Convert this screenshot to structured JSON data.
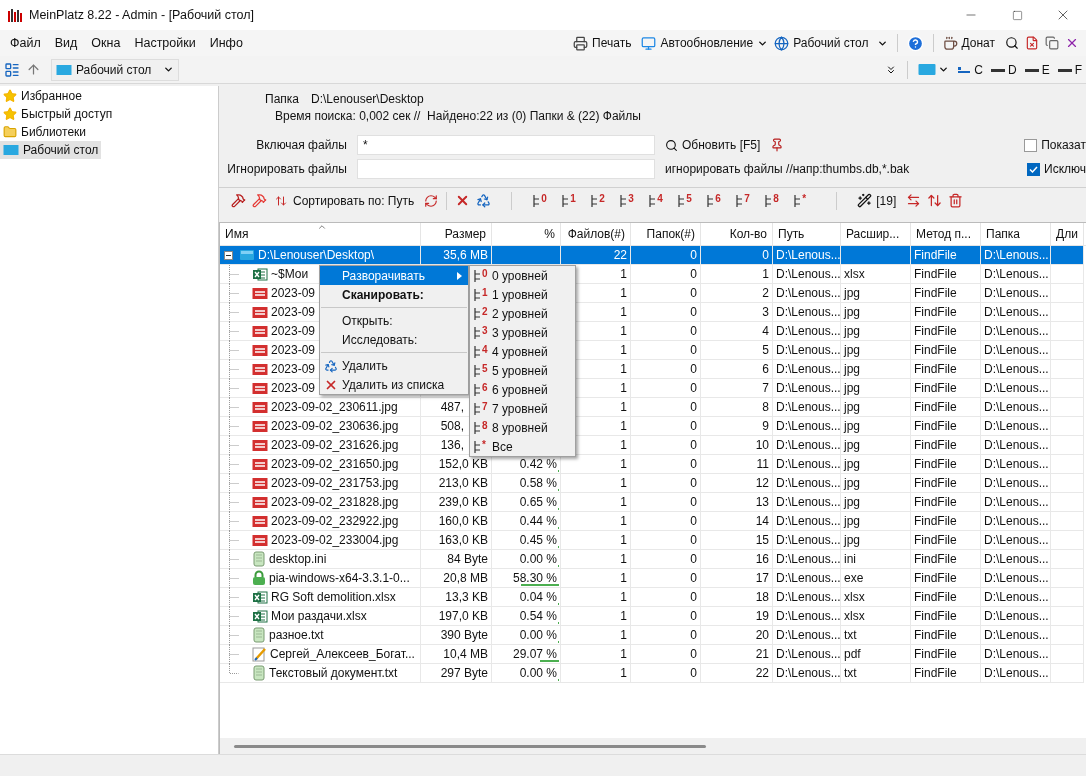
{
  "window": {
    "title": "MeinPlatz 8.22 - Admin - [Рабочий стол]"
  },
  "menu": [
    "Файл",
    "Вид",
    "Окна",
    "Настройки",
    "Инфо"
  ],
  "top_toolbar": {
    "print": "Печать",
    "auto_update": "Автообновление",
    "location": "Рабочий стол",
    "donate": "Донат"
  },
  "nav_toolbar": {
    "location": "Рабочий стол",
    "drives": [
      "C",
      "D",
      "E",
      "F"
    ]
  },
  "sidebar": {
    "items": [
      {
        "label": "Избранное",
        "kind": "star",
        "selected": false
      },
      {
        "label": "Быстрый доступ",
        "kind": "star",
        "selected": false
      },
      {
        "label": "Библиотеки",
        "kind": "folder",
        "selected": false
      },
      {
        "label": "Рабочий стол",
        "kind": "desktop",
        "selected": true
      }
    ]
  },
  "info": {
    "folder_label": "Папка",
    "folder": "D:\\Lenouser\\Desktop",
    "stats": "Время поиска: 0,002 сек //  Найдено:22 из (0) Папки & (22) Файлы"
  },
  "filters": {
    "include_label": "Включая файлы",
    "include_value": "*",
    "ignore_label": "Игнорировать файлы",
    "refresh": "Обновить [F5]",
    "ignore_hint": "игнорировать файлы //напр:thumbs.db,*.bak",
    "options": [
      {
        "label": "Показат",
        "checked": false
      },
      {
        "label": "Исключ",
        "checked": true
      }
    ]
  },
  "list_toolbar": {
    "sort": "Сортировать по: Путь",
    "levels": [
      "0",
      "1",
      "2",
      "3",
      "4",
      "5",
      "6",
      "7",
      "8",
      "*"
    ],
    "count": "[19]"
  },
  "table": {
    "columns": [
      "Имя",
      "Размер",
      "%",
      "Файлов(#)",
      "Папок(#)",
      "Кол-во",
      "Путь",
      "Расшир...",
      "Метод п...",
      "Папка",
      "Дли"
    ],
    "rows": [
      {
        "kind": "folder",
        "name": "D:\\Lenouser\\Desktop\\",
        "selected": true,
        "expanded": true,
        "size": "35,6 MB",
        "files": "22",
        "folders": "0",
        "count": "0",
        "path": "D:\\Lenous...",
        "method": "FindFile",
        "folder": "D:\\Lenous...",
        "children": [
          {
            "kind": "spreadsheet",
            "name": "~$Мои",
            "selected": false,
            "files": "1",
            "folders": "0",
            "count": "1",
            "path": "D:\\Lenous...",
            "ext": "xlsx",
            "method": "FindFile",
            "folder": "D:\\Lenous..."
          },
          {
            "kind": "image",
            "name": "2023-09",
            "selected": false,
            "files": "1",
            "folders": "0",
            "count": "2",
            "path": "D:\\Lenous...",
            "ext": "jpg",
            "method": "FindFile",
            "folder": "D:\\Lenous..."
          },
          {
            "kind": "image",
            "name": "2023-09",
            "selected": false,
            "files": "1",
            "folders": "0",
            "count": "3",
            "path": "D:\\Lenous...",
            "ext": "jpg",
            "method": "FindFile",
            "folder": "D:\\Lenous..."
          },
          {
            "kind": "image",
            "name": "2023-09",
            "selected": false,
            "files": "1",
            "folders": "0",
            "count": "4",
            "path": "D:\\Lenous...",
            "ext": "jpg",
            "method": "FindFile",
            "folder": "D:\\Lenous..."
          },
          {
            "kind": "image",
            "name": "2023-09",
            "selected": false,
            "files": "1",
            "folders": "0",
            "count": "5",
            "path": "D:\\Lenous...",
            "ext": "jpg",
            "method": "FindFile",
            "folder": "D:\\Lenous..."
          },
          {
            "kind": "image",
            "name": "2023-09",
            "selected": false,
            "files": "1",
            "folders": "0",
            "count": "6",
            "path": "D:\\Lenous...",
            "ext": "jpg",
            "method": "FindFile",
            "folder": "D:\\Lenous..."
          },
          {
            "kind": "image",
            "name": "2023-09",
            "selected": false,
            "files": "1",
            "folders": "0",
            "count": "7",
            "path": "D:\\Lenous...",
            "ext": "jpg",
            "method": "FindFile",
            "folder": "D:\\Lenous..."
          },
          {
            "kind": "image",
            "name": "2023-09-02_230611.jpg",
            "selected": false,
            "size": "487,",
            "size_cut": true,
            "files": "1",
            "folders": "0",
            "count": "8",
            "path": "D:\\Lenous...",
            "ext": "jpg",
            "method": "FindFile",
            "folder": "D:\\Lenous..."
          },
          {
            "kind": "image",
            "name": "2023-09-02_230636.jpg",
            "selected": false,
            "size": "508,",
            "size_cut": true,
            "files": "1",
            "folders": "0",
            "count": "9",
            "path": "D:\\Lenous...",
            "ext": "jpg",
            "method": "FindFile",
            "folder": "D:\\Lenous..."
          },
          {
            "kind": "image",
            "name": "2023-09-02_231626.jpg",
            "selected": false,
            "size": "136,",
            "size_cut": true,
            "files": "1",
            "folders": "0",
            "count": "10",
            "path": "D:\\Lenous...",
            "ext": "jpg",
            "method": "FindFile",
            "folder": "D:\\Lenous..."
          },
          {
            "kind": "image",
            "name": "2023-09-02_231650.jpg",
            "selected": false,
            "size": "152,0 KB",
            "percent": "0.42 %",
            "level": 0.0042,
            "files": "1",
            "folders": "0",
            "count": "11",
            "path": "D:\\Lenous...",
            "ext": "jpg",
            "method": "FindFile",
            "folder": "D:\\Lenous..."
          },
          {
            "kind": "image",
            "name": "2023-09-02_231753.jpg",
            "selected": false,
            "size": "213,0 KB",
            "percent": "0.58 %",
            "level": 0.0058,
            "files": "1",
            "folders": "0",
            "count": "12",
            "path": "D:\\Lenous...",
            "ext": "jpg",
            "method": "FindFile",
            "folder": "D:\\Lenous..."
          },
          {
            "kind": "image",
            "name": "2023-09-02_231828.jpg",
            "selected": false,
            "size": "239,0 KB",
            "percent": "0.65 %",
            "level": 0.0065,
            "files": "1",
            "folders": "0",
            "count": "13",
            "path": "D:\\Lenous...",
            "ext": "jpg",
            "method": "FindFile",
            "folder": "D:\\Lenous..."
          },
          {
            "kind": "image",
            "name": "2023-09-02_232922.jpg",
            "selected": false,
            "size": "160,0 KB",
            "percent": "0.44 %",
            "level": 0.0044,
            "files": "1",
            "folders": "0",
            "count": "14",
            "path": "D:\\Lenous...",
            "ext": "jpg",
            "method": "FindFile",
            "folder": "D:\\Lenous..."
          },
          {
            "kind": "image",
            "name": "2023-09-02_233004.jpg",
            "selected": false,
            "size": "163,0 KB",
            "percent": "0.45 %",
            "level": 0.0045,
            "files": "1",
            "folders": "0",
            "count": "15",
            "path": "D:\\Lenous...",
            "ext": "jpg",
            "method": "FindFile",
            "folder": "D:\\Lenous..."
          },
          {
            "kind": "text",
            "name": "desktop.ini",
            "selected": false,
            "size": "84 Byte",
            "percent": "0.00 %",
            "level": 0,
            "files": "1",
            "folders": "0",
            "count": "16",
            "path": "D:\\Lenous...",
            "ext": "ini",
            "method": "FindFile",
            "folder": "D:\\Lenous..."
          },
          {
            "kind": "installer",
            "name": "pia-windows-x64-3.3.1-0...",
            "selected": false,
            "size": "20,8 MB",
            "percent": "58.30 %",
            "level": 0.583,
            "files": "1",
            "folders": "0",
            "count": "17",
            "path": "D:\\Lenous...",
            "ext": "exe",
            "method": "FindFile",
            "folder": "D:\\Lenous..."
          },
          {
            "kind": "spreadsheet",
            "name": "RG Soft demolition.xlsx",
            "selected": false,
            "size": "13,3 KB",
            "percent": "0.04 %",
            "level": 0.0004,
            "files": "1",
            "folders": "0",
            "count": "18",
            "path": "D:\\Lenous...",
            "ext": "xlsx",
            "method": "FindFile",
            "folder": "D:\\Lenous..."
          },
          {
            "kind": "spreadsheet",
            "name": "Мои раздачи.xlsx",
            "selected": false,
            "size": "197,0 KB",
            "percent": "0.54 %",
            "level": 0.0054,
            "files": "1",
            "folders": "0",
            "count": "19",
            "path": "D:\\Lenous...",
            "ext": "xlsx",
            "method": "FindFile",
            "folder": "D:\\Lenous..."
          },
          {
            "kind": "text",
            "name": "разное.txt",
            "selected": false,
            "size": "390 Byte",
            "percent": "0.00 %",
            "level": 0,
            "files": "1",
            "folders": "0",
            "count": "20",
            "path": "D:\\Lenous...",
            "ext": "txt",
            "method": "FindFile",
            "folder": "D:\\Lenous..."
          },
          {
            "kind": "document",
            "name": "Сергей_Алексеев_Богат...",
            "selected": false,
            "size": "10,4 MB",
            "percent": "29.07 %",
            "level": 0.2907,
            "files": "1",
            "folders": "0",
            "count": "21",
            "path": "D:\\Lenous...",
            "ext": "pdf",
            "method": "FindFile",
            "folder": "D:\\Lenous..."
          },
          {
            "kind": "text",
            "name": "Текстовый документ.txt",
            "selected": false,
            "size": "297 Byte",
            "percent": "0.00 %",
            "level": 0,
            "files": "1",
            "folders": "0",
            "count": "22",
            "path": "D:\\Lenous...",
            "ext": "txt",
            "method": "FindFile",
            "folder": "D:\\Lenous..."
          }
        ]
      }
    ]
  },
  "context_menu": {
    "items": [
      {
        "kind": "submenu",
        "label": "Разворачивать",
        "selected": true,
        "bold": false
      },
      {
        "kind": "item",
        "label": "Сканировать:",
        "selected": false,
        "bold": true
      },
      {
        "kind": "separator"
      },
      {
        "kind": "item",
        "label": "Открыть:",
        "selected": false,
        "bold": false
      },
      {
        "kind": "item",
        "label": "Исследовать:",
        "selected": false,
        "bold": false
      },
      {
        "kind": "separator"
      },
      {
        "kind": "delete",
        "label": "Удалить",
        "selected": false,
        "bold": false
      },
      {
        "kind": "remove",
        "label": "Удалить из списка",
        "selected": false,
        "bold": false
      }
    ]
  },
  "submenu": {
    "items": [
      {
        "badge": "0",
        "label": "0 уровней"
      },
      {
        "badge": "1",
        "label": "1 уровней"
      },
      {
        "badge": "2",
        "label": "2 уровней"
      },
      {
        "badge": "3",
        "label": "3 уровней"
      },
      {
        "badge": "4",
        "label": "4 уровней"
      },
      {
        "badge": "5",
        "label": "5 уровней"
      },
      {
        "badge": "6",
        "label": "6 уровней"
      },
      {
        "badge": "7",
        "label": "7 уровней"
      },
      {
        "badge": "8",
        "label": "8 уровней"
      },
      {
        "badge": "*",
        "label": "Все"
      }
    ]
  }
}
